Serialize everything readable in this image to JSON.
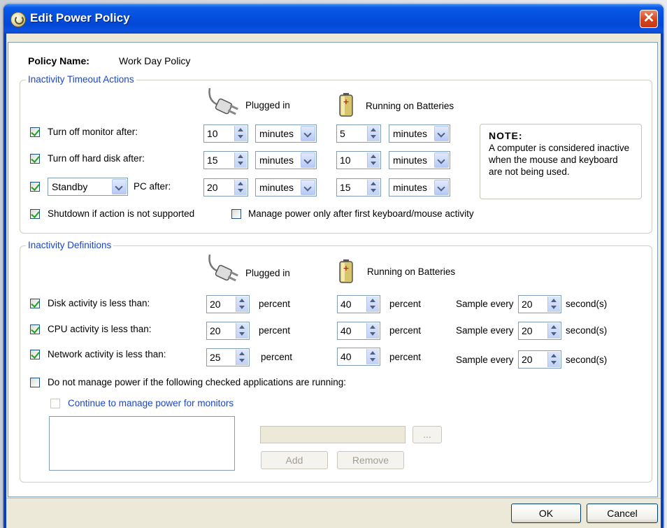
{
  "window": {
    "title": "Edit Power Policy",
    "close_label": "✕"
  },
  "policy": {
    "name_label": "Policy Name:",
    "name_value": "Work Day Policy"
  },
  "timeout": {
    "legend": "Inactivity Timeout Actions",
    "plugged_label": "Plugged in",
    "battery_label": "Running on Batteries",
    "rows": [
      {
        "label": "Turn off monitor after:",
        "checked": true,
        "plugged_value": "10",
        "plugged_unit": "minutes",
        "battery_value": "5",
        "battery_unit": "minutes"
      },
      {
        "label": "Turn off hard disk after:",
        "checked": true,
        "plugged_value": "15",
        "plugged_unit": "minutes",
        "battery_value": "10",
        "battery_unit": "minutes"
      },
      {
        "action": "Standby",
        "label": "PC after:",
        "checked": true,
        "plugged_value": "20",
        "plugged_unit": "minutes",
        "battery_value": "15",
        "battery_unit": "minutes"
      }
    ],
    "shutdown_label": "Shutdown if action is not supported",
    "manage_after_label": "Manage power only after first keyboard/mouse activity",
    "note_title": "NOTE:",
    "note_text": "A computer is considered inactive when the mouse and keyboard are not being used."
  },
  "definitions": {
    "legend": "Inactivity Definitions",
    "plugged_label": "Plugged in",
    "battery_label": "Running on Batteries",
    "unit": "percent",
    "sample_label": "Sample every",
    "sample_unit": "second(s)",
    "rows": [
      {
        "label": "Disk activity is less than:",
        "plugged_value": "20",
        "battery_value": "40",
        "sample_value": "20"
      },
      {
        "label": "CPU activity is less than:",
        "plugged_value": "20",
        "battery_value": "40",
        "sample_value": "20"
      },
      {
        "label": "Network activity is less than:",
        "plugged_value": "25",
        "battery_value": "40",
        "sample_value": "20"
      }
    ],
    "apps_label": "Do not manage power if the following checked applications are running:",
    "monitors_label": "Continue to manage power for monitors",
    "browse_label": "...",
    "add_label": "Add",
    "remove_label": "Remove"
  },
  "buttons": {
    "ok": "OK",
    "cancel": "Cancel"
  },
  "colors": {
    "title_bar": "#0550e0",
    "legend_text": "#1a46c8",
    "check_mark": "#21a121",
    "close_button": "#d5441c"
  }
}
